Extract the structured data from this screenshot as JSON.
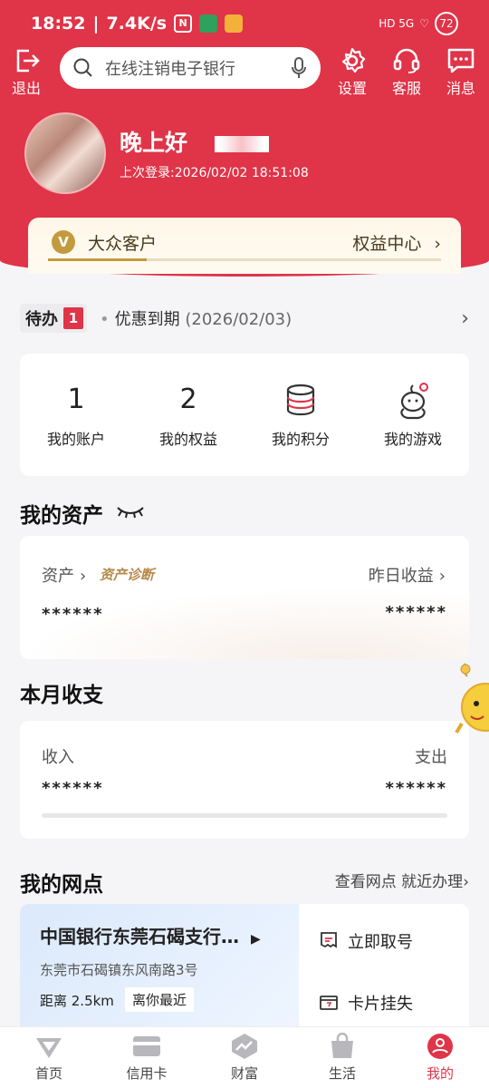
{
  "status_bar": {
    "time": "18:52",
    "speed": "7.4K/s",
    "nfc_icon": "N",
    "right_text": "HD 5G",
    "battery": "72"
  },
  "header": {
    "logout_label": "退出",
    "search_placeholder": "在线注销电子银行",
    "settings_label": "设置",
    "service_label": "客服",
    "message_label": "消息"
  },
  "profile": {
    "greeting": "晚上好",
    "last_login": "上次登录:2026/02/02 18:51:08"
  },
  "member": {
    "badge": "V",
    "level": "大众客户",
    "benefits_link": "权益中心",
    "progress": 0.25
  },
  "todo": {
    "tag": "待办",
    "count": "1",
    "text": "优惠到期",
    "date": "(2026/02/03)"
  },
  "quick_items": [
    {
      "value": "1",
      "label": "我的账户"
    },
    {
      "value": "2",
      "label": "我的权益"
    },
    {
      "value": "",
      "label": "我的积分",
      "icon": "coin-stack-icon"
    },
    {
      "value": "",
      "label": "我的游戏",
      "icon": "mascot-icon"
    }
  ],
  "assets": {
    "title": "我的资产",
    "asset_label": "资产",
    "diagnosis": "资产诊断",
    "yesterday_label": "昨日收益",
    "asset_value": "******",
    "yesterday_value": "******"
  },
  "monthly": {
    "title": "本月收支",
    "income_label": "收入",
    "expense_label": "支出",
    "income_value": "******",
    "expense_value": "******"
  },
  "branch": {
    "title": "我的网点",
    "more": "查看网点 就近办理",
    "name": "中国银行东莞石碣支行…",
    "address": "东莞市石碣镇东风南路3号",
    "distance": "距离 2.5km",
    "nearest": "离你最近",
    "service_1": "立即取号",
    "service_2": "卡片挂失"
  },
  "tabs": [
    {
      "label": "首页",
      "icon": "home-icon"
    },
    {
      "label": "信用卡",
      "icon": "credit-card-icon"
    },
    {
      "label": "财富",
      "icon": "wealth-icon"
    },
    {
      "label": "生活",
      "icon": "shopping-bag-icon"
    },
    {
      "label": "我的",
      "icon": "profile-icon"
    }
  ],
  "colors": {
    "brand": "#e03448",
    "gold": "#c49a3f"
  }
}
